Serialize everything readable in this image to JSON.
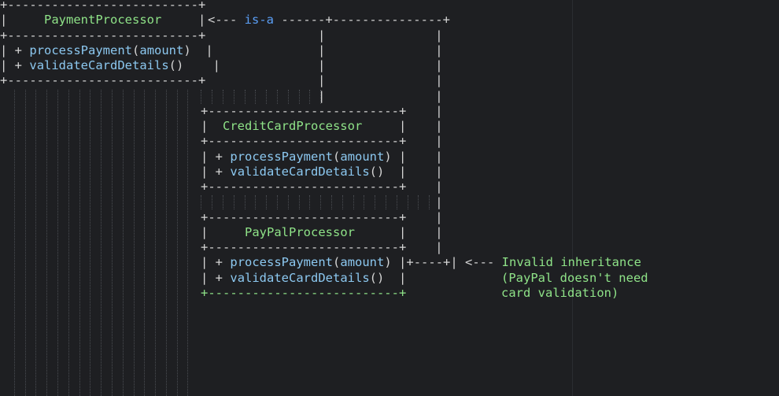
{
  "diagram": {
    "relationship_label": "is-a",
    "note_lines": [
      "Invalid inheritance",
      "(PayPal doesn't need",
      "card validation)"
    ],
    "classes": [
      {
        "name": "PaymentProcessor",
        "methods": [
          {
            "name": "processPayment",
            "arg": "amount"
          },
          {
            "name": "validateCardDetails",
            "arg": ""
          }
        ]
      },
      {
        "name": "CreditCardProcessor",
        "methods": [
          {
            "name": "processPayment",
            "arg": "amount"
          },
          {
            "name": "validateCardDetails",
            "arg": ""
          }
        ]
      },
      {
        "name": "PayPalProcessor",
        "methods": [
          {
            "name": "processPayment",
            "arg": "amount"
          },
          {
            "name": "validateCardDetails",
            "arg": ""
          }
        ]
      }
    ]
  }
}
